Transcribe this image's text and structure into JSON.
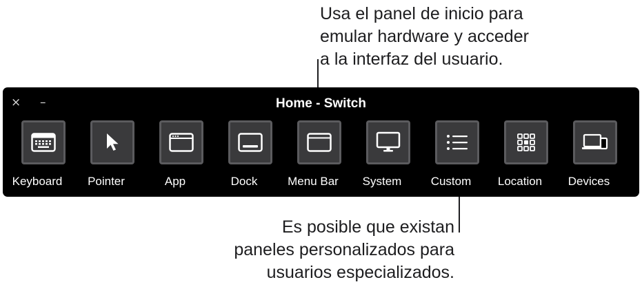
{
  "callouts": {
    "top": {
      "lines": [
        "Usa el panel de inicio para",
        "emular hardware y acceder",
        "a la interfaz del usuario."
      ]
    },
    "bottom": {
      "lines": [
        "Es posible que existan",
        "paneles personalizados para",
        "usuarios especializados."
      ]
    }
  },
  "panel": {
    "title": "Home - Switch",
    "close_label": "×",
    "minimize_label": "–",
    "tiles": [
      {
        "label": "Keyboard",
        "icon": "keyboard-icon"
      },
      {
        "label": "Pointer",
        "icon": "pointer-icon"
      },
      {
        "label": "App",
        "icon": "app-window-icon"
      },
      {
        "label": "Dock",
        "icon": "dock-icon"
      },
      {
        "label": "Menu Bar",
        "icon": "menu-bar-icon"
      },
      {
        "label": "System",
        "icon": "monitor-icon"
      },
      {
        "label": "Custom",
        "icon": "list-icon"
      },
      {
        "label": "Location",
        "icon": "grid-icon"
      },
      {
        "label": "Devices",
        "icon": "devices-icon"
      }
    ]
  },
  "colors": {
    "panel_bg": "#000000",
    "tile_bg": "#3a3a3c",
    "tile_border": "#5b5b5e",
    "text": "#ffffff",
    "callout_text": "#1d1d1f"
  }
}
